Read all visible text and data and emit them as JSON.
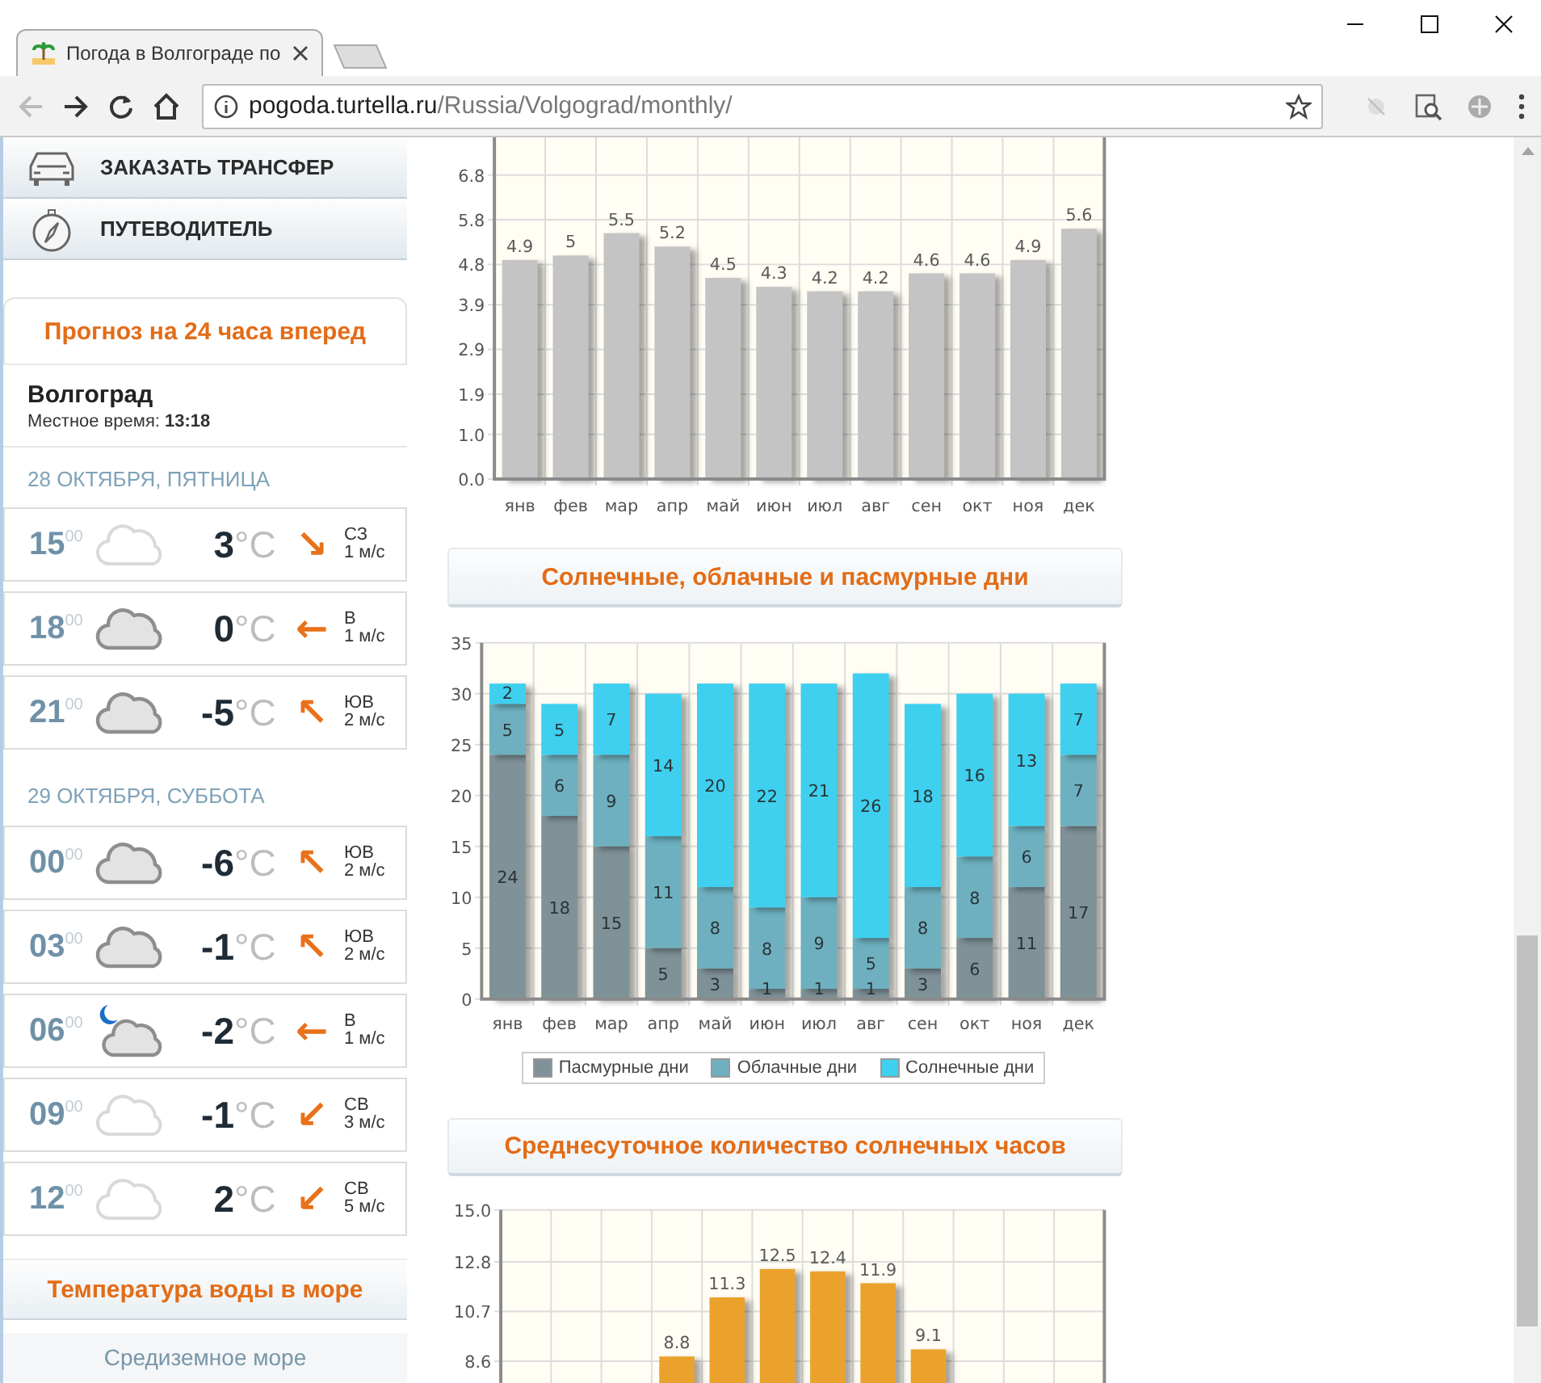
{
  "browser": {
    "tab_title": "Погода в Волгограде по",
    "url_host": "pogoda.turtella.ru",
    "url_path": "/Russia/Volgograd/monthly/"
  },
  "sidebar": {
    "menu": [
      {
        "label": "ЗАКАЗАТЬ ТРАНСФЕР"
      },
      {
        "label": "ПУТЕВОДИТЕЛЬ"
      }
    ],
    "forecast": {
      "title": "Прогноз на 24 часа вперед",
      "city": "Волгоград",
      "local_time": "Местное время: **13:18**",
      "days": [
        {
          "date": "28 ОКТЯБРЯ, ПЯТНИЦА",
          "hours": [
            {
              "hour": "15",
              "minutes": "00",
              "kind": "light",
              "temp": "3",
              "unit": "°C",
              "arrow": "↘",
              "wind_dir": "СЗ",
              "wind_speed": "1 м/с"
            },
            {
              "hour": "18",
              "minutes": "00",
              "kind": "overcast",
              "temp": "0",
              "unit": "°C",
              "arrow": "←",
              "wind_dir": "В",
              "wind_speed": "1 м/с"
            },
            {
              "hour": "21",
              "minutes": "00",
              "kind": "overcast",
              "temp": "-5",
              "unit": "°C",
              "arrow": "↖",
              "wind_dir": "ЮВ",
              "wind_speed": "2 м/с"
            }
          ]
        },
        {
          "date": "29 ОКТЯБРЯ, СУББОТА",
          "hours": [
            {
              "hour": "00",
              "minutes": "00",
              "kind": "overcast",
              "temp": "-6",
              "unit": "°C",
              "arrow": "↖",
              "wind_dir": "ЮВ",
              "wind_speed": "2 м/с"
            },
            {
              "hour": "03",
              "minutes": "00",
              "kind": "overcast",
              "temp": "-1",
              "unit": "°C",
              "arrow": "↖",
              "wind_dir": "ЮВ",
              "wind_speed": "2 м/с"
            },
            {
              "hour": "06",
              "minutes": "00",
              "kind": "night",
              "temp": "-2",
              "unit": "°C",
              "arrow": "←",
              "wind_dir": "В",
              "wind_speed": "1 м/с"
            },
            {
              "hour": "09",
              "minutes": "00",
              "kind": "light",
              "temp": "-1",
              "unit": "°C",
              "arrow": "↙",
              "wind_dir": "СВ",
              "wind_speed": "3 м/с"
            },
            {
              "hour": "12",
              "minutes": "00",
              "kind": "light",
              "temp": "2",
              "unit": "°C",
              "arrow": "↙",
              "wind_dir": "СВ",
              "wind_speed": "5 м/с"
            }
          ]
        }
      ]
    },
    "sea": {
      "title": "Температура воды в море",
      "item": "Средиземное море"
    }
  },
  "main": {
    "charts": [
      {
        "chart_data": {
          "type": "bar",
          "categories": [
            "янв",
            "фев",
            "мар",
            "апр",
            "май",
            "июн",
            "июл",
            "авг",
            "сен",
            "окт",
            "ноя",
            "дек"
          ],
          "series": [
            {
              "color": "#c4c4c4",
              "values": [
                4.9,
                5,
                5.5,
                5.2,
                4.5,
                4.3,
                4.2,
                4.2,
                4.6,
                4.6,
                4.9,
                5.6
              ]
            }
          ],
          "value_labels": [
            "4.9",
            "5",
            "5.5",
            "5.2",
            "4.5",
            "4.3",
            "4.2",
            "4.2",
            "4.6",
            "4.6",
            "4.9",
            "5.6"
          ],
          "ylim": [
            0,
            7.75
          ],
          "yticks": [
            {
              "value": 0,
              "label": "0.0"
            },
            {
              "value": 1,
              "label": "1.0"
            },
            1.9,
            2.9,
            3.9,
            4.8,
            5.8,
            6.8
          ],
          "data_labels": true,
          "grid": true
        }
      },
      {
        "heading": "Солнечные, облачные и пасмурные дни",
        "chart_data": {
          "type": "bar",
          "stacked": true,
          "categories": [
            "янв",
            "фев",
            "мар",
            "апр",
            "май",
            "июн",
            "июл",
            "авг",
            "сен",
            "окт",
            "ноя",
            "дек"
          ],
          "series": [
            {
              "name": "Пасмурные дни",
              "color": "#7f9298",
              "values": [
                24,
                18,
                15,
                5,
                3,
                1,
                1,
                1,
                3,
                6,
                11,
                17
              ]
            },
            {
              "name": "Облачные дни",
              "color": "#6eb0bf",
              "values": [
                5,
                6,
                9,
                11,
                8,
                8,
                9,
                5,
                8,
                8,
                6,
                7
              ]
            },
            {
              "name": "Солнечные дни",
              "color": "#3ed0ee",
              "values": [
                2,
                5,
                7,
                14,
                20,
                22,
                21,
                26,
                18,
                16,
                13,
                7
              ]
            }
          ],
          "ylim": [
            0,
            35
          ],
          "yticks": [
            0,
            5,
            10,
            15,
            20,
            25,
            30,
            35
          ],
          "data_labels": true,
          "grid": true
        }
      },
      {
        "heading": "Среднесуточное количество солнечных часов",
        "chart_data": {
          "type": "bar",
          "series": [
            {
              "color": "#eba22c",
              "values": [
                null,
                null,
                null,
                8.8,
                11.3,
                12.5,
                12.4,
                11.9,
                9.1,
                null,
                null,
                null
              ]
            }
          ],
          "value_labels": [
            null,
            null,
            null,
            "8.8",
            "11.3",
            "12.5",
            "12.4",
            "11.9",
            "9.1",
            null,
            null,
            null
          ],
          "ylim": [
            0,
            15
          ],
          "yticks": [
            {
              "value": 15,
              "label": "15.0"
            },
            12.8,
            10.7,
            8.6
          ],
          "data_labels": true,
          "grid": true
        }
      }
    ]
  }
}
